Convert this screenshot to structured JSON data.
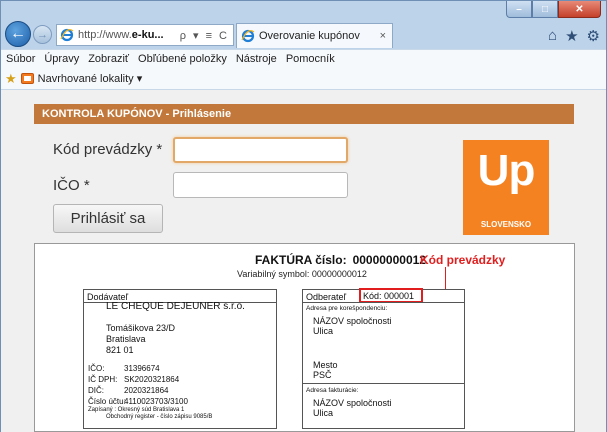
{
  "browser": {
    "address_prefix": "http://www.",
    "address_domain": "e-ku...",
    "address_tools": "ρ ▾ ≡ C",
    "tab_title": "Overovanie kupónov",
    "tab_close": "×",
    "right_icons": [
      "home-icon",
      "star-icon",
      "gear-icon"
    ],
    "window_controls": [
      "minimize",
      "maximize",
      "close"
    ]
  },
  "menu": {
    "items": [
      "Súbor",
      "Úpravy",
      "Zobraziť",
      "Obľúbené položky",
      "Nástroje",
      "Pomocník"
    ]
  },
  "favorites": {
    "suggested_label": "Navrhované lokality ▾"
  },
  "panel": {
    "title": "KONTROLA KUPÓNOV - Prihlásenie"
  },
  "form": {
    "code_label": "Kód prevádzky *",
    "code_value": "",
    "ico_label": "IČO *",
    "ico_value": "",
    "login_button": "Prihlásiť sa"
  },
  "logo": {
    "text": "Up",
    "tagline": "SLOVENSKO"
  },
  "colors": {
    "panel_header": "#c2783a",
    "logo_orange": "#f58220",
    "highlight_red": "#e21d1d"
  },
  "invoice": {
    "title": "FAKTÚRA číslo:",
    "number": "00000000012",
    "kod_callout": "Kód prevádzky",
    "variable_symbol": "Variabilný symbol: 00000000012",
    "supplier": {
      "header": "Dodávateľ",
      "name": "LE CHEQUE DEJEUNER s.r.o.",
      "street": "Tomášikova 23/D",
      "city": "Bratislava",
      "zip": "821 01",
      "ico_label": "IČO:",
      "ico": "31396674",
      "icdph_label": "IČ DPH:",
      "icdph": "SK2020321864",
      "dic_label": "DIČ:",
      "dic": "2020321864",
      "account_label": "Číslo účtu:",
      "account": "4110023703/3100",
      "note_line1": "Zapísaný : Okresný súd Bratislava 1",
      "note_line2": "Obchodný register - číslo zápisu 9085/B"
    },
    "buyer": {
      "header": "Odberateľ",
      "kod": "Kód: 000001",
      "corr_label": "Adresa pre korešpondenciu:",
      "name1": "NÁZOV spoločnosti",
      "street1": "Ulica",
      "city1": "Mesto",
      "zip1": "PSČ",
      "billing_label": "Adresa fakturácie:",
      "name2": "NÁZOV spoločnosti",
      "street2": "Ulica"
    }
  }
}
